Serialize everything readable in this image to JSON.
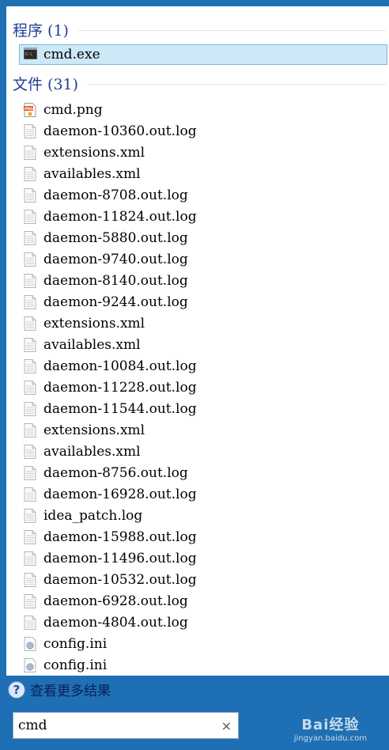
{
  "programs_header": "程序 (1)",
  "program_item": "cmd.exe",
  "files_header": "文件 (31)",
  "files": [
    {
      "name": "cmd.png",
      "icon": "png-file-icon"
    },
    {
      "name": "daemon-10360.out.log",
      "icon": "text-file-icon"
    },
    {
      "name": "extensions.xml",
      "icon": "text-file-icon"
    },
    {
      "name": "availables.xml",
      "icon": "text-file-icon"
    },
    {
      "name": "daemon-8708.out.log",
      "icon": "text-file-icon"
    },
    {
      "name": "daemon-11824.out.log",
      "icon": "text-file-icon"
    },
    {
      "name": "daemon-5880.out.log",
      "icon": "text-file-icon"
    },
    {
      "name": "daemon-9740.out.log",
      "icon": "text-file-icon"
    },
    {
      "name": "daemon-8140.out.log",
      "icon": "text-file-icon"
    },
    {
      "name": "daemon-9244.out.log",
      "icon": "text-file-icon"
    },
    {
      "name": "extensions.xml",
      "icon": "text-file-icon"
    },
    {
      "name": "availables.xml",
      "icon": "text-file-icon"
    },
    {
      "name": "daemon-10084.out.log",
      "icon": "text-file-icon"
    },
    {
      "name": "daemon-11228.out.log",
      "icon": "text-file-icon"
    },
    {
      "name": "daemon-11544.out.log",
      "icon": "text-file-icon"
    },
    {
      "name": "extensions.xml",
      "icon": "text-file-icon"
    },
    {
      "name": "availables.xml",
      "icon": "text-file-icon"
    },
    {
      "name": "daemon-8756.out.log",
      "icon": "text-file-icon"
    },
    {
      "name": "daemon-16928.out.log",
      "icon": "text-file-icon"
    },
    {
      "name": "idea_patch.log",
      "icon": "text-file-icon"
    },
    {
      "name": "daemon-15988.out.log",
      "icon": "text-file-icon"
    },
    {
      "name": "daemon-11496.out.log",
      "icon": "text-file-icon"
    },
    {
      "name": "daemon-10532.out.log",
      "icon": "text-file-icon"
    },
    {
      "name": "daemon-6928.out.log",
      "icon": "text-file-icon"
    },
    {
      "name": "daemon-4804.out.log",
      "icon": "text-file-icon"
    },
    {
      "name": "config.ini",
      "icon": "config-file-icon"
    },
    {
      "name": "config.ini",
      "icon": "config-file-icon"
    }
  ],
  "see_more": "查看更多结果",
  "search": {
    "value": "cmd",
    "clear_symbol": "×"
  },
  "watermark": {
    "main": "Bai经验",
    "sub": "jingyan.baidu.com"
  },
  "colors": {
    "taskbar": "#1e6fb3",
    "selected_bg": "#cde8f6",
    "header_text": "#1e3f8f"
  }
}
